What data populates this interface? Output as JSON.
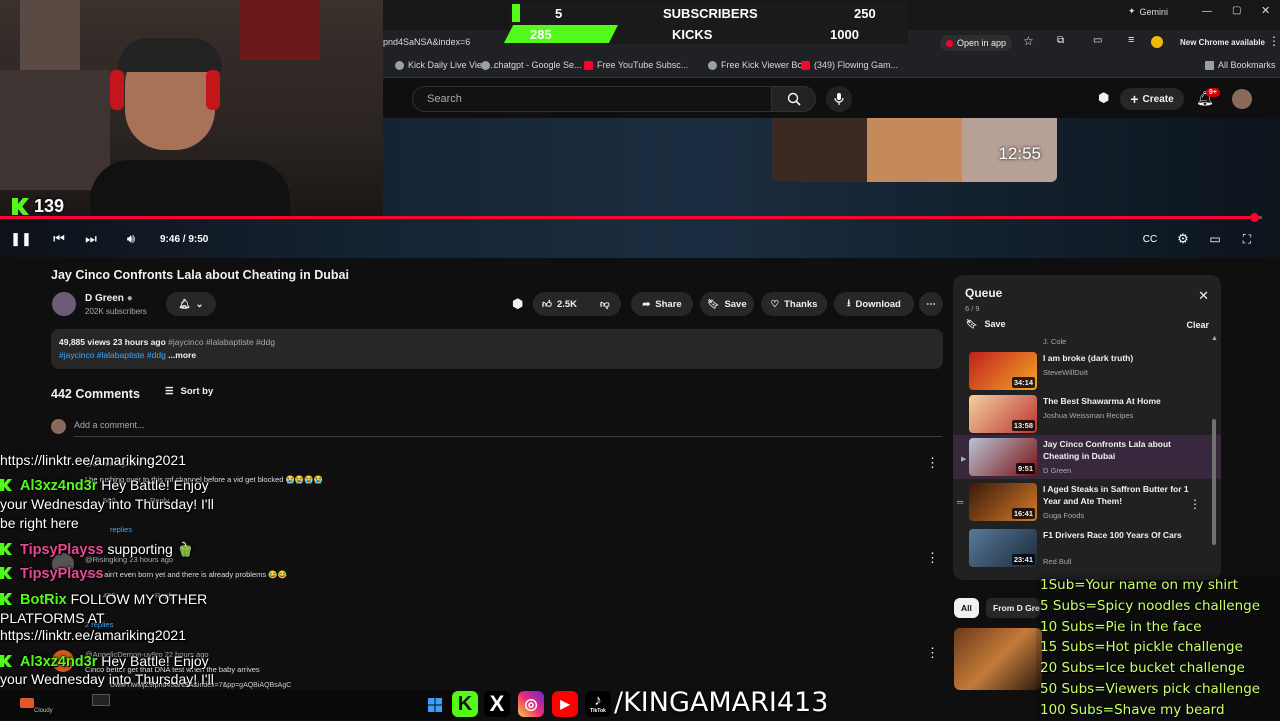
{
  "browser": {
    "url_fragment": "pnd4SaNSA&index=6",
    "gemini_label": "Gemini",
    "open_in_app": "Open in app",
    "chrome_notice": "New Chrome available",
    "bookmarks": [
      "Kick Daily Live View...",
      "chatgpt - Google Se...",
      "Free YouTube Subsc...",
      "Free Kick Viewer Bot",
      "(349) Flowing Gam..."
    ],
    "all_bookmarks": "All Bookmarks"
  },
  "youtube_header": {
    "search_placeholder": "Search",
    "create_label": "Create",
    "notif_badge": "9+"
  },
  "stream_overlay": {
    "sub_left": "5",
    "sub_label": "SUBSCRIBERS",
    "sub_right": "250",
    "kick_left": "285",
    "kick_label": "KICKS",
    "kick_right": "1000",
    "viewer_count": "139",
    "sub_progress": 0.02,
    "kick_progress": 0.285
  },
  "player": {
    "time": "9:46 / 9:50",
    "thumb_duration": "12:55",
    "progress": 0.994
  },
  "video": {
    "title": "Jay Cinco Confronts Lala about Cheating in Dubai",
    "channel": "D Green",
    "subscribers": "202K subscribers",
    "likes": "2.5K",
    "share": "Share",
    "save": "Save",
    "thanks": "Thanks",
    "download": "Download",
    "views_line": "49,885 views  23 hours ago",
    "tags_line1": "#jaycinco #lalabaptiste #ddg",
    "tags_line2": "#jaycinco #lalabaptiste #ddg",
    "more": "...more"
  },
  "comments": {
    "count": "442 Comments",
    "sort": "Sort by",
    "add_placeholder": "Add a comment...",
    "items": [
      {
        "author": "@amariking2021",
        "text": "I be rushing over to this mf channel before a vid get blocked 😭😭😭😭"
      },
      {
        "author": "@Risingking",
        "time": "23 hours ago",
        "text": "Baby ain't even born yet and there is already problems 😂😂",
        "replies": "2 replies"
      },
      {
        "author": "@AngelicDemon-uy9ro",
        "time": "22 hours ago",
        "text": "Cinco better get that DNA test when the baby arrives"
      }
    ],
    "replies_label": "replies",
    "reply_label": "Reply",
    "like_count": "560",
    "like_count2": "459"
  },
  "chat": [
    {
      "user": "",
      "text": "https://linktr.ee/amariking2021"
    },
    {
      "user": "Al3xz4nd3r",
      "text": " Hey Battle! Enjoy"
    },
    {
      "user": "",
      "text": "your Wednesday into Thursday! I'll"
    },
    {
      "user": "",
      "text": "be right here"
    },
    {
      "user": "TipsyPlayss",
      "text": " supporting 🫑"
    },
    {
      "user": "TipsyPlayss",
      "text": ""
    },
    {
      "user": "BotRix",
      "text": " FOLLOW MY OTHER"
    },
    {
      "user": "",
      "text": "PLATFORMS AT"
    },
    {
      "user": "",
      "text": "https://linktr.ee/amariking2021"
    },
    {
      "user": "Al3xz4nd3r",
      "text": " Hey Battle! Enjoy"
    },
    {
      "user": "",
      "text": "your Wednesday into Thursday! I'll"
    }
  ],
  "queue": {
    "title": "Queue",
    "position": "6 / 9",
    "save": "Save",
    "clear": "Clear",
    "top_channel": "J. Cole",
    "items": [
      {
        "title": "I am broke (dark truth)",
        "channel": "SteveWillDoIt",
        "duration": "34:14"
      },
      {
        "title": "The Best Shawarma At Home",
        "channel": "Joshua Weissman Recipes",
        "duration": "13:58"
      },
      {
        "title": "Jay Cinco Confronts Lala about Cheating in Dubai",
        "channel": "D Green",
        "duration": "9:51"
      },
      {
        "title": "I Aged Steaks in Saffron Butter for 1 Year and Ate Them!",
        "channel": "Guga Foods",
        "duration": "16:41"
      },
      {
        "title": "F1 Drivers Race 100 Years Of Cars",
        "channel": "Red Bull",
        "duration": "23:41"
      }
    ]
  },
  "chips": [
    "All",
    "From D Gre"
  ],
  "goals": [
    "1Sub=Your name on my shirt",
    "5 Subs=Spicy noodles challenge",
    "10 Subs=Pie in the face",
    "15 Subs=Hot pickle challenge",
    "20 Subs=Ice bucket challenge",
    "50 Subs=Viewers pick challenge",
    "100 Subs=Shave my beard"
  ],
  "banner": {
    "handle": "/KINGAMARI413",
    "tiktok_label": "TikTok"
  },
  "taskbar": {
    "weather": "Cloudy",
    "url_snippet": "UwMTIwMjZ9fpnd4SaNSA&index=7&pp=gAQBiAQBsAgC"
  },
  "colors": {
    "kick_green": "#53fc18",
    "yt_red": "#ff0033",
    "goal_green": "#c8ff6a",
    "link_blue": "#3ea6ff"
  }
}
